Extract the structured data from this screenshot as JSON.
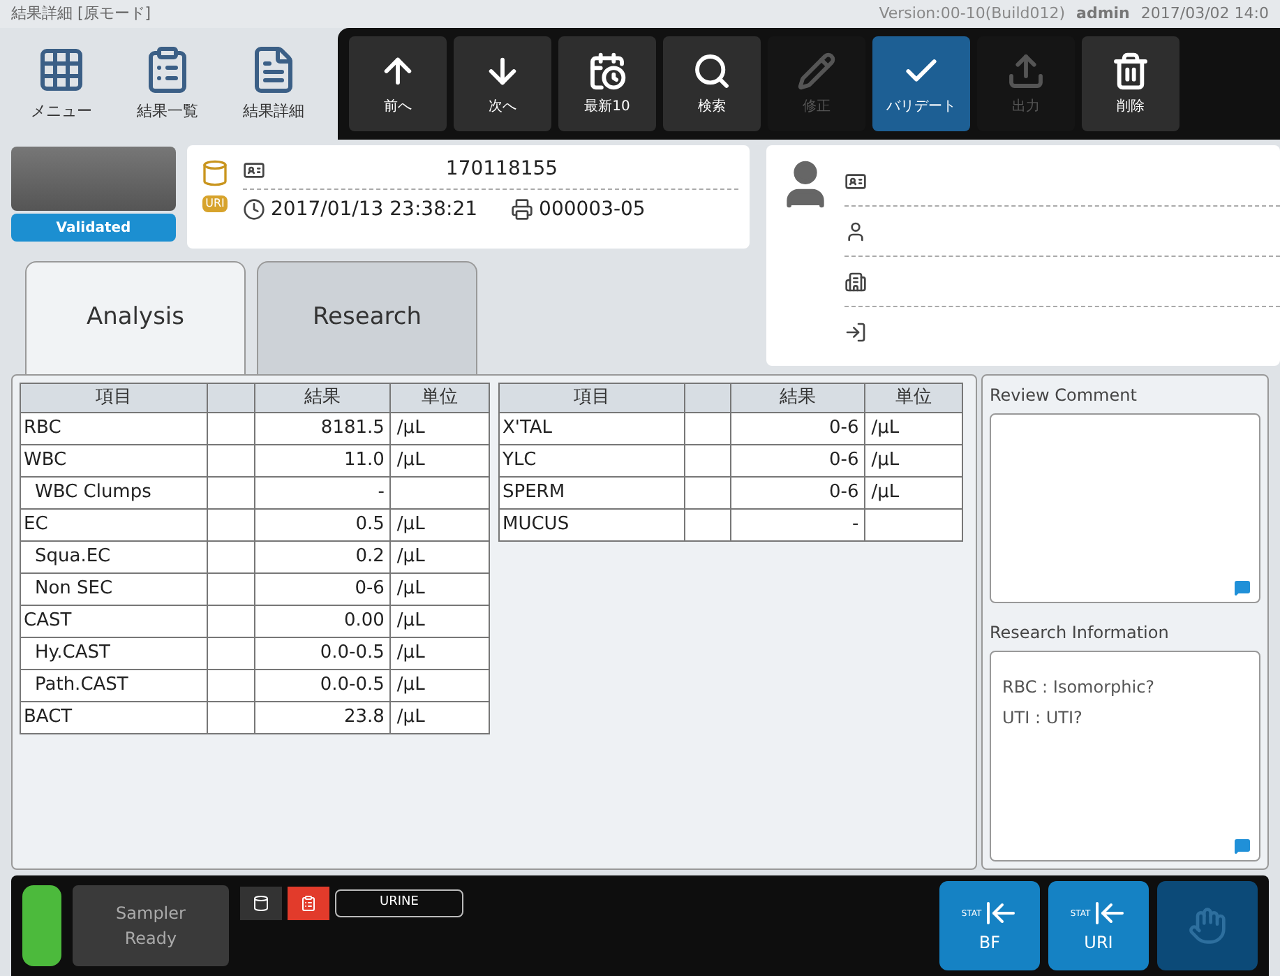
{
  "title_bar": {
    "title": "結果詳細 [原モード]",
    "version": "Version:00-10(Build012)",
    "user": "admin",
    "datetime": "2017/03/02 14:0"
  },
  "nav_buttons": [
    {
      "label": "メニュー"
    },
    {
      "label": "結果一覧"
    },
    {
      "label": "結果詳細"
    }
  ],
  "toolbar": [
    {
      "label": "前へ",
      "disabled": false,
      "selected": false
    },
    {
      "label": "次へ",
      "disabled": false,
      "selected": false
    },
    {
      "label": "最新10",
      "disabled": false,
      "selected": false
    },
    {
      "label": "検索",
      "disabled": false,
      "selected": false
    },
    {
      "label": "修正",
      "disabled": true,
      "selected": false
    },
    {
      "label": "バリデート",
      "disabled": false,
      "selected": true
    },
    {
      "label": "出力",
      "disabled": true,
      "selected": false
    },
    {
      "label": "削除",
      "disabled": false,
      "selected": false
    }
  ],
  "status": {
    "label": "Validated"
  },
  "sample": {
    "type": "URI",
    "id": "170118155",
    "datetime": "2017/01/13 23:38:21",
    "rack": "000003-05"
  },
  "tabs": [
    {
      "label": "Analysis",
      "selected": true
    },
    {
      "label": "Research",
      "selected": false
    }
  ],
  "left_table": {
    "columns": [
      "項目",
      "結果",
      "単位"
    ],
    "rows": [
      {
        "item": "RBC",
        "result": "8181.5",
        "unit": "/μL"
      },
      {
        "item": "WBC",
        "result": "11.0",
        "unit": "/μL",
        "children": [
          {
            "item": "WBC Clumps",
            "result": "-"
          }
        ]
      },
      {
        "item": "EC",
        "result": "0.5",
        "unit": "/μL",
        "children": [
          {
            "item": "Squa.EC",
            "result": "0.2",
            "unit": "/μL"
          },
          {
            "item": "Non SEC",
            "result": "0-6",
            "unit": "/μL"
          }
        ]
      },
      {
        "item": "CAST",
        "result": "0.00",
        "unit": "/μL",
        "children": [
          {
            "item": "Hy.CAST",
            "result": "0.0-0.5",
            "unit": "/μL"
          },
          {
            "item": "Path.CAST",
            "result": "0.0-0.5",
            "unit": "/μL"
          }
        ]
      },
      {
        "item": "BACT",
        "result": "23.8",
        "unit": "/μL"
      }
    ]
  },
  "right_table": {
    "columns": [
      "項目",
      "結果",
      "単位"
    ],
    "rows": [
      {
        "item": "X'TAL",
        "result": "0-6",
        "unit": "/μL"
      },
      {
        "item": "YLC",
        "result": "0-6",
        "unit": "/μL"
      },
      {
        "item": "SPERM",
        "result": "0-6",
        "unit": "/μL"
      },
      {
        "item": "MUCUS",
        "result": "-"
      }
    ]
  },
  "review_comment": {
    "title": "Review Comment"
  },
  "research_information": {
    "title": "Research Information",
    "lines": [
      "RBC : Isomorphic?",
      "UTI : UTI?"
    ]
  },
  "bottom_bar": {
    "sampler_on": true,
    "sampler_status": "Sampler Ready",
    "rack_type": "URINE",
    "stat_buttons": [
      {
        "stat": "STAT",
        "label": "BF",
        "disabled": false
      },
      {
        "stat": "STAT",
        "label": "URI",
        "disabled": false
      },
      {
        "disabled": true
      }
    ]
  }
}
